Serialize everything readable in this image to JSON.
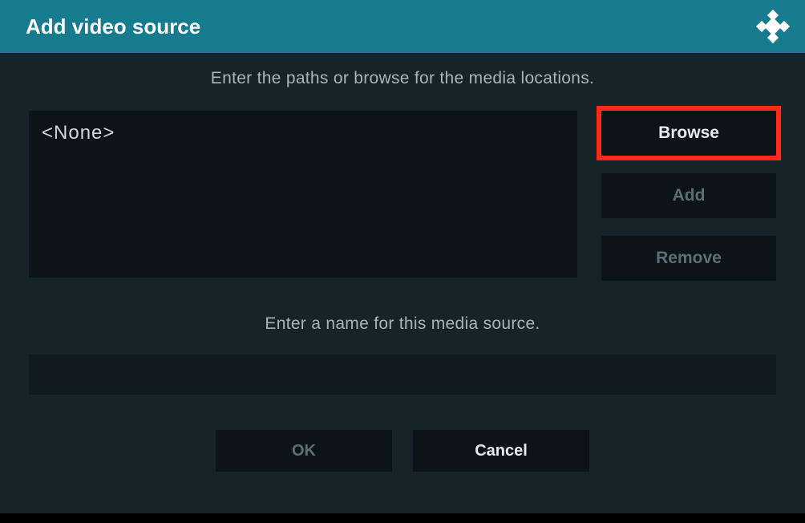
{
  "titlebar": {
    "title": "Add video source"
  },
  "instructions": {
    "paths": "Enter the paths or browse for the media locations.",
    "name": "Enter a name for this media source."
  },
  "pathList": {
    "value": "<None>"
  },
  "buttons": {
    "browse": "Browse",
    "add": "Add",
    "remove": "Remove",
    "ok": "OK",
    "cancel": "Cancel"
  },
  "nameInput": {
    "value": ""
  },
  "colors": {
    "accent": "#177b8f",
    "highlight": "#ff2a1a",
    "background": "#17232a",
    "panel": "#0d1418"
  }
}
